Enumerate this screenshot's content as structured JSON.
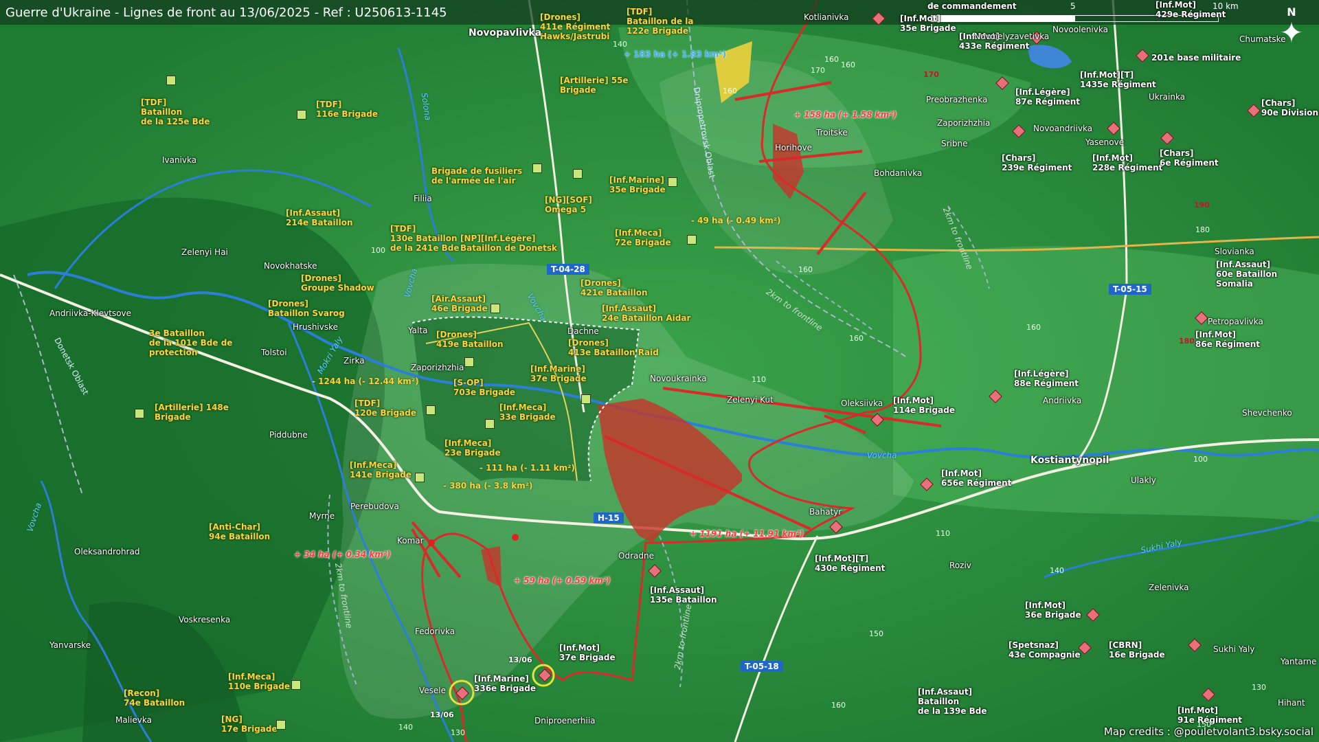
{
  "title": "Guerre d'Ukraine - Lignes de front au 13/06/2025 - Ref : U250613-1145",
  "scale": {
    "zero": "0",
    "mid": "5",
    "end": "10 km"
  },
  "north": "N",
  "credits": "Map credits : @pouletvolant3.bsky.social",
  "colors": {
    "ua_label": "#ffd23a",
    "ru_label": "#ffffff",
    "ru_advance": "#c8352a",
    "terrain": "#2f8f3c",
    "river": "#2b7fd9",
    "road_badge": "#1e66c9"
  },
  "ua_units": [
    {
      "text": "[Drones]\n411e Régiment\nHawks/Jastrubi"
    },
    {
      "text": "[TDF]\nBataillon de la\n122e Brigade"
    },
    {
      "text": "[Artillerie] 55e\nBrigade"
    },
    {
      "text": "[TDF]\nBataillon\nde la 125e Bde"
    },
    {
      "text": "[TDF]\n116e Brigade"
    },
    {
      "text": "Brigade de fusiliers\nde l'armée de l'air"
    },
    {
      "text": "[Inf.Marine]\n35e Brigade"
    },
    {
      "text": "[NG][SOF]\nOmega 5"
    },
    {
      "text": "[Inf.Assaut]\n214e Bataillon"
    },
    {
      "text": "[TDF]\n130e Bataillon\nde la 241e Bde"
    },
    {
      "text": "[NP][Inf.Légère]\nBataillon de Donetsk"
    },
    {
      "text": "[Inf.Meca]\n72e Brigade"
    },
    {
      "text": "[Drones]\nGroupe Shadow"
    },
    {
      "text": "[Drones]\n421e Bataillon"
    },
    {
      "text": "[Drones]\nBataillon Svarog"
    },
    {
      "text": "[Air.Assaut]\n46e Brigade"
    },
    {
      "text": "[Inf.Assaut]\n24e Bataillon Aidar"
    },
    {
      "text": "3e Bataillon\nde la 101e Bde de\nprotection"
    },
    {
      "text": "[Drones]\n419e Bataillon"
    },
    {
      "text": "[Drones]\n413e Bataillon Raid"
    },
    {
      "text": "[Inf.Marine]\n37e Brigade"
    },
    {
      "text": "[S-OP]\n703e Brigade"
    },
    {
      "text": "[Artillerie] 148e\nBrigade"
    },
    {
      "text": "[TDF]\n120e Brigade"
    },
    {
      "text": "[Inf.Meca]\n33e Brigade"
    },
    {
      "text": "[Inf.Meca]\n23e Brigade"
    },
    {
      "text": "[Inf.Meca]\n141e Brigade"
    },
    {
      "text": "[Anti-Char]\n94e Bataillon"
    },
    {
      "text": "[Inf.Meca]\n110e Brigade"
    },
    {
      "text": "[Recon]\n74e Bataillon"
    },
    {
      "text": "[NG]\n17e Brigade"
    }
  ],
  "ru_units": [
    {
      "text": "de commandement"
    },
    {
      "text": "[Inf.Mot]\n35e Brigade"
    },
    {
      "text": "[Inf.Mot]\n429e Régiment"
    },
    {
      "text": "[Inf.Mot]\n433e Régiment"
    },
    {
      "text": "201e base militaire"
    },
    {
      "text": "[Inf.Mot][T]\n1435e Régiment"
    },
    {
      "text": "[Inf.Légère]\n87e Régiment"
    },
    {
      "text": "[Chars]\n90e Division"
    },
    {
      "text": "[Chars]\n239e Régiment"
    },
    {
      "text": "[Inf.Mot]\n228e Régiment"
    },
    {
      "text": "[Chars]\n6e Régiment"
    },
    {
      "text": "[Inf.Assaut]\n60e Bataillon\nSomalia"
    },
    {
      "text": "[Inf.Mot]\n86e Régiment"
    },
    {
      "text": "[Inf.Légère]\n88e Régiment"
    },
    {
      "text": "[Inf.Mot]\n114e Brigade"
    },
    {
      "text": "[Inf.Mot]\n656e Régiment"
    },
    {
      "text": "[Inf.Mot][T]\n430e Régiment"
    },
    {
      "text": "[Inf.Assaut]\n135e Bataillon"
    },
    {
      "text": "[Inf.Mot]\n37e Brigade"
    },
    {
      "text": "[Inf.Marine]\n336e Brigade"
    },
    {
      "text": "[Inf.Mot]\n36e Brigade"
    },
    {
      "text": "[Spetsnaz]\n43e Compagnie"
    },
    {
      "text": "[CBRN]\n16e Brigade"
    },
    {
      "text": "[Inf.Assaut]\nBataillon\nde la 139e Bde"
    },
    {
      "text": "[Inf.Mot]\n91e Régiment"
    }
  ],
  "towns": [
    "Novopavlivka",
    "Kotlianivka",
    "Novoielyzavetivka",
    "Novoolenivka",
    "Chumatske",
    "Ivanivka",
    "Preobrazhenka",
    "Zaporizhzhia",
    "Ukrainka",
    "Troitske",
    "Novoandriivka",
    "Yasenove",
    "Horihove",
    "Sribne",
    "Bohdanivka",
    "Filiia",
    "Zelenyi Hai",
    "Novokhatske",
    "Slovianka",
    "Andriivka-Klevtsove",
    "Hrushivske",
    "Yalta",
    "Dachne",
    "Petropavlivka",
    "Zirka",
    "Tolstoi",
    "Zaporizhzhia",
    "Novoukrainka",
    "Zelenyi Kut",
    "Oleksiivka",
    "Andriivka",
    "Shevchenko",
    "Piddubne",
    "Kostiantynopil",
    "Ulakly",
    "Bahatyr",
    "Myrne",
    "Perebudova",
    "Komar",
    "Odradne",
    "Oleksandrohrad",
    "Roziv",
    "Zelenivka",
    "Voskresenka",
    "Sukhi Yaly",
    "Yanvarske",
    "Fedorivka",
    "Yantarne",
    "Vesele",
    "Hihant",
    "Malievka",
    "Dniproenerhiia"
  ],
  "rivers": [
    "Solona",
    "Vovcha",
    "Mokri Yaly",
    "Vovcha",
    "Vovcha",
    "Sukhi Yaly",
    "Vovcha"
  ],
  "oblasts": [
    "Dnipropetrovsk Oblast",
    "Donetsk Oblast"
  ],
  "roads": [
    "T-04-28",
    "T-05-15",
    "H-15",
    "T-05-18"
  ],
  "frontline_notes": [
    "2km to frontline",
    "2km to frontline",
    "2km to frontline",
    "2km to frontline"
  ],
  "areas": [
    {
      "text": "+ 183 ha (+ 1.83 km²)",
      "kind": "blue"
    },
    {
      "text": "+ 158 ha (+ 1.58 km²)",
      "kind": "ru"
    },
    {
      "text": "- 49 ha (- 0.49 km²)",
      "kind": "ua"
    },
    {
      "text": "- 1244 ha (- 12.44 km²)",
      "kind": "ua"
    },
    {
      "text": "- 111 ha (- 1.11 km²)",
      "kind": "ua"
    },
    {
      "text": "- 380 ha (- 3.8 km²)",
      "kind": "ua"
    },
    {
      "text": "+ 1191 ha (+ 11.91 km²)",
      "kind": "ru"
    },
    {
      "text": "+ 34 ha (+ 0.34 km²)",
      "kind": "ru"
    },
    {
      "text": "+ 59 ha (+ 0.59 km²)",
      "kind": "ru"
    }
  ],
  "elevations": [
    "140",
    "160",
    "170",
    "160",
    "110",
    "100",
    "170",
    "190",
    "180",
    "160",
    "160",
    "180",
    "160",
    "100",
    "110",
    "140",
    "150",
    "160",
    "130",
    "150",
    "130",
    "140",
    "160"
  ],
  "dates": [
    "13/06",
    "13/06"
  ]
}
